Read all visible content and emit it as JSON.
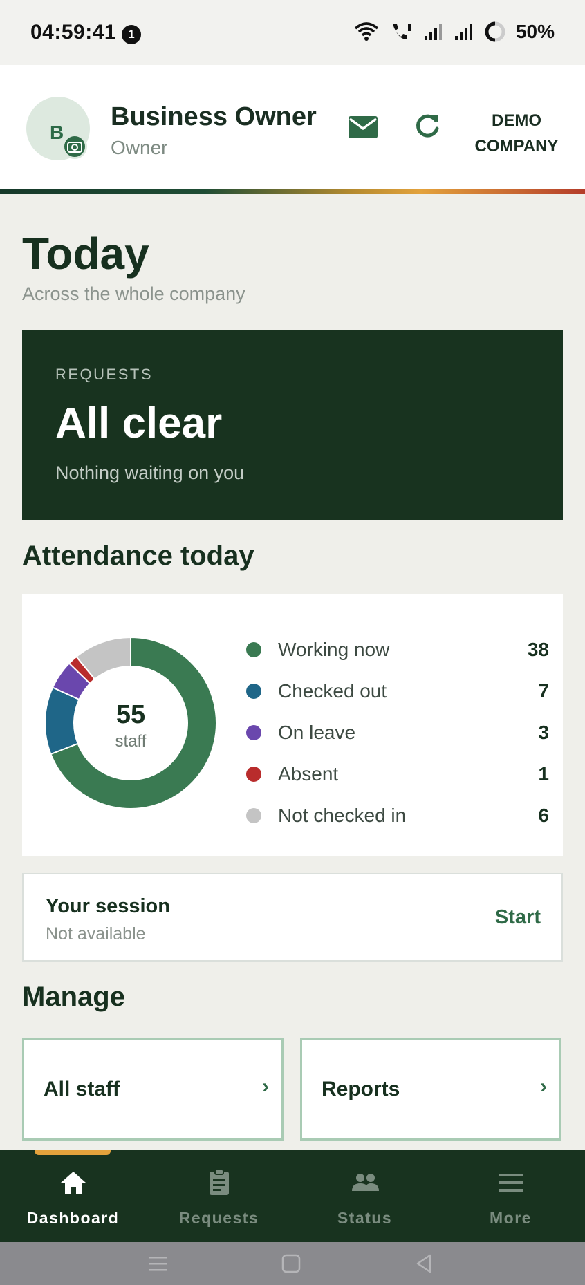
{
  "status_bar": {
    "time": "04:59:41",
    "notification_count": "1",
    "battery": "50%"
  },
  "header": {
    "avatar_initial": "B",
    "user_name": "Business Owner",
    "user_role": "Owner",
    "company_line1": "DEMO",
    "company_line2": "COMPANY"
  },
  "today": {
    "title": "Today",
    "subtitle": "Across the whole company"
  },
  "requests": {
    "label": "REQUESTS",
    "title": "All clear",
    "subtitle": "Nothing waiting on you"
  },
  "attendance": {
    "title": "Attendance today",
    "total": "55",
    "total_label": "staff",
    "items": [
      {
        "label": "Working now",
        "value": 38,
        "color": "#3a7a52"
      },
      {
        "label": "Checked out",
        "value": 7,
        "color": "#1f6688"
      },
      {
        "label": "On leave",
        "value": 3,
        "color": "#6a47ad"
      },
      {
        "label": "Absent",
        "value": 1,
        "color": "#b92c2c"
      },
      {
        "label": "Not checked in",
        "value": 6,
        "color": "#c4c4c4"
      }
    ]
  },
  "session": {
    "title": "Your session",
    "status": "Not available",
    "action": "Start"
  },
  "manage": {
    "title": "Manage",
    "tiles": [
      {
        "label": "All staff",
        "chevron": "›"
      },
      {
        "label": "Reports",
        "chevron": "›"
      }
    ]
  },
  "bottom_nav": {
    "items": [
      {
        "label": "Dashboard",
        "icon": "home-icon",
        "active": true
      },
      {
        "label": "Requests",
        "icon": "clipboard-icon",
        "active": false
      },
      {
        "label": "Status",
        "icon": "people-icon",
        "active": false
      },
      {
        "label": "More",
        "icon": "menu-icon",
        "active": false
      }
    ]
  },
  "colors": {
    "primary_dark": "#18331f",
    "accent_green": "#2f6a47",
    "accent_gold": "#e3a23c"
  }
}
